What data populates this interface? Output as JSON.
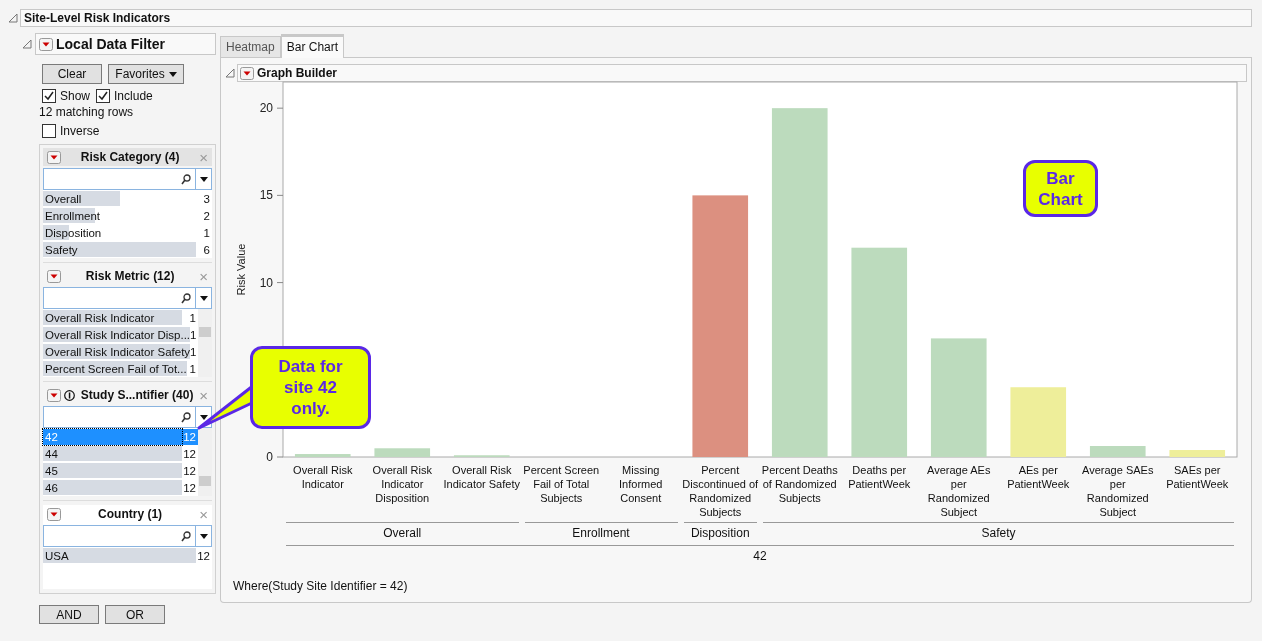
{
  "window": {
    "title": "Site-Level Risk Indicators"
  },
  "filter": {
    "title": "Local Data Filter",
    "buttons": [
      {
        "label": "Clear",
        "kind": "plain"
      },
      {
        "label": "Favorites",
        "kind": "menu"
      }
    ],
    "options": [
      {
        "label": "Show",
        "checked": true
      },
      {
        "label": "Include",
        "checked": true
      }
    ],
    "matching": "12 matching rows",
    "inverse": {
      "label": "Inverse",
      "checked": false
    },
    "sections": [
      {
        "title": "Risk Category (4)",
        "close": "×",
        "info": false,
        "scrollable": false,
        "items": [
          {
            "label": "Overall",
            "count": "3",
            "level": 0.5,
            "selected": false
          },
          {
            "label": "Enrollment",
            "count": "2",
            "level": 0.34,
            "selected": false
          },
          {
            "label": "Disposition",
            "count": "1",
            "level": 0.17,
            "selected": false
          },
          {
            "label": "Safety",
            "count": "6",
            "level": 1,
            "selected": false
          }
        ]
      },
      {
        "title": "Risk Metric (12)",
        "close": "×",
        "info": false,
        "scrollable": true,
        "items": [
          {
            "label": "Overall Risk Indicator",
            "count": "1",
            "level": 1,
            "selected": false
          },
          {
            "label": "Overall Risk Indicator Disp...",
            "count": "1",
            "level": 1,
            "selected": false
          },
          {
            "label": "Overall Risk Indicator Safety",
            "count": "1",
            "level": 1,
            "selected": false
          },
          {
            "label": "Percent Screen Fail of Tot...",
            "count": "1",
            "level": 1,
            "selected": false
          }
        ]
      },
      {
        "title": "Study S...ntifier (40)",
        "close": "×",
        "info": true,
        "scrollable": true,
        "items": [
          {
            "label": "42",
            "count": "12",
            "selected": true
          },
          {
            "label": "44",
            "count": "12",
            "level": 1,
            "selected": false
          },
          {
            "label": "45",
            "count": "12",
            "level": 1,
            "selected": false
          },
          {
            "label": "46",
            "count": "12",
            "level": 1,
            "selected": false
          }
        ]
      },
      {
        "title": "Country (1)",
        "close": "×",
        "info": false,
        "scrollable": false,
        "items": [
          {
            "label": "USA",
            "count": "12",
            "level": 1,
            "selected": false
          }
        ]
      }
    ],
    "logic_buttons": [
      "AND",
      "OR"
    ]
  },
  "tabs": [
    {
      "label": "Heatmap",
      "selected": false
    },
    {
      "label": "Bar Chart",
      "selected": true
    }
  ],
  "graph": {
    "title": "Graph Builder",
    "chart_data": {
      "type": "bar",
      "ylabel": "Risk Value",
      "xlabel": "42",
      "categories": [
        "Overall Risk Indicator",
        "Overall Risk Indicator Disposition",
        "Overall Risk Indicator Safety",
        "Percent Screen Fail of Total Subjects",
        "Missing Informed Consent",
        "Percent Discontinued of Randomized Subjects",
        "Percent Deaths of Randomized Subjects",
        "Deaths per PatientWeek",
        "Average AEs per Randomized Subject",
        "AEs per PatientWeek",
        "Average SAEs per Randomized Subject",
        "SAEs per PatientWeek"
      ],
      "values": [
        0.17,
        0.5,
        0.1,
        0,
        0,
        15,
        20,
        12,
        6.8,
        4,
        0.63,
        0.4
      ],
      "colors": [
        "#bcdbbd",
        "#bcdbbd",
        "#bcdbbd",
        null,
        null,
        "#dc9080",
        "#bcdbbd",
        "#bcdbbd",
        "#bcdbbd",
        "#eeee9a",
        "#bcdbbd",
        "#eeee9a"
      ],
      "ylim": [
        0,
        21.5
      ],
      "yticks": [
        0,
        10,
        15,
        20
      ]
    },
    "x_groups": [
      {
        "label": "Overall"
      },
      {
        "label": "Enrollment"
      },
      {
        "label": "Disposition"
      },
      {
        "label": "Safety"
      }
    ],
    "where": "Where(Study Site Identifier = 42)"
  },
  "callouts": [
    {
      "text": "Data for site 42 only.",
      "kind": "pointer"
    },
    {
      "text": "Bar Chart",
      "kind": "plain"
    }
  ]
}
